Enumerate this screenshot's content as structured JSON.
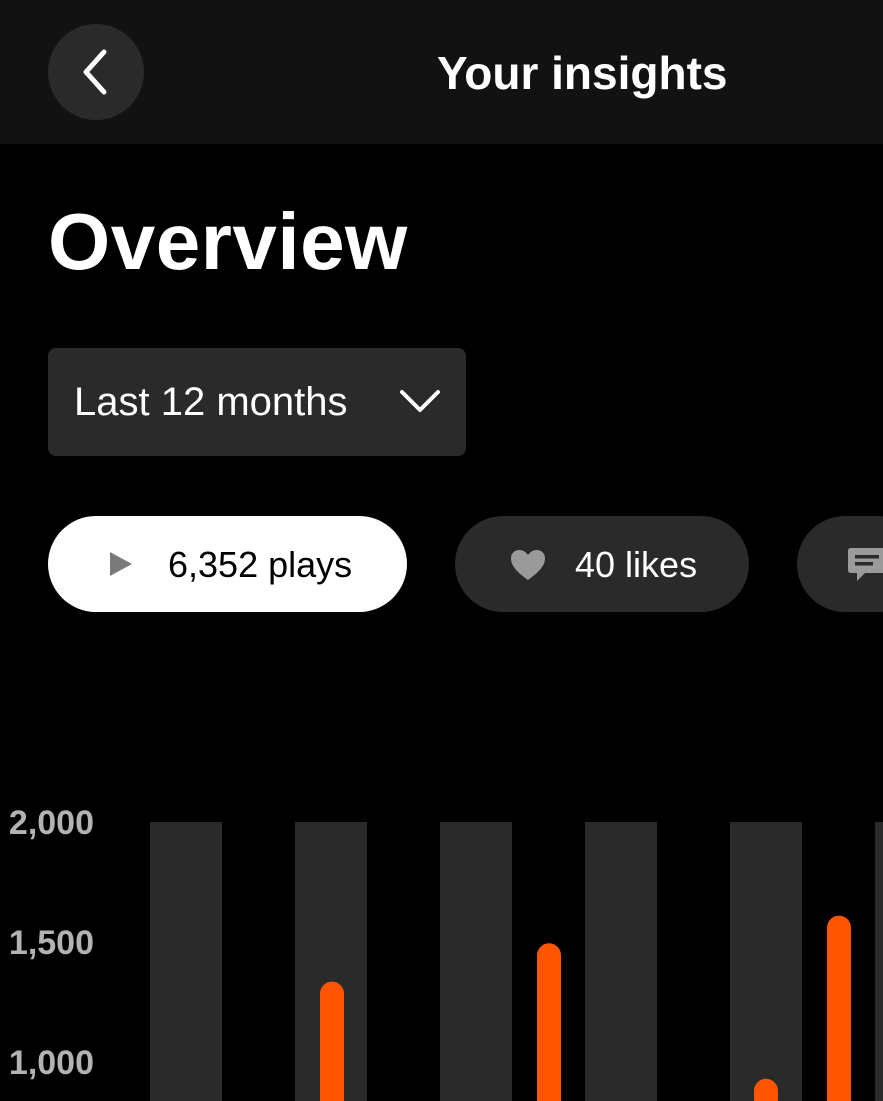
{
  "header": {
    "title": "Your insights",
    "back_icon": "chevron-left-icon"
  },
  "page": {
    "title": "Overview"
  },
  "filter": {
    "period_label": "Last 12 months",
    "icon": "chevron-down-icon"
  },
  "stats": {
    "plays_label": "6,352 plays",
    "likes_label": "40 likes",
    "plays_icon": "play-icon",
    "likes_icon": "heart-icon",
    "comments_icon": "comment-icon"
  },
  "colors": {
    "background": "#000000",
    "topbar": "#121212",
    "surface": "#2a2a2a",
    "accent": "#ff5500",
    "tick_text": "#b3b3b3"
  },
  "chart_data": {
    "type": "bar",
    "y_ticks": [
      "2,000",
      "1,500",
      "1,000"
    ],
    "ylim": [
      0,
      2000
    ],
    "values": [
      1335,
      1495,
      930,
      1610
    ],
    "grid": "alternating column bands"
  }
}
